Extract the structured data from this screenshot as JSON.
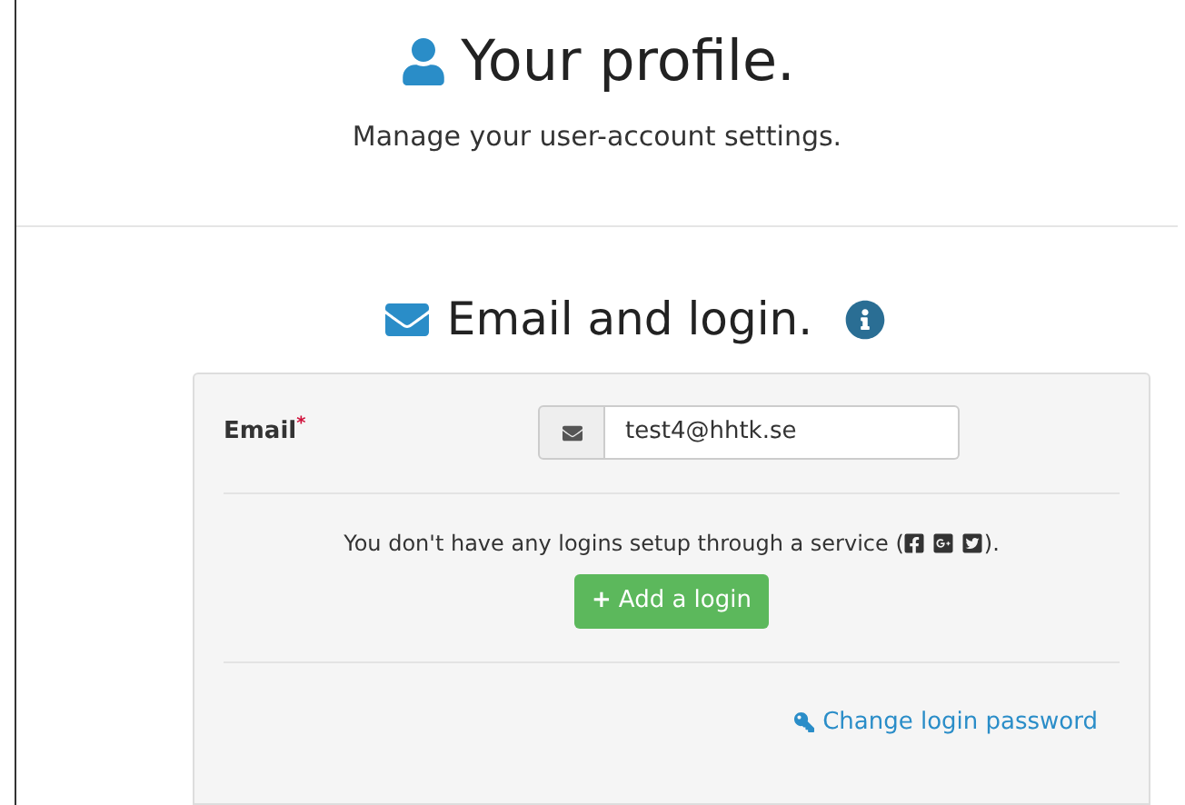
{
  "header": {
    "title": "Your profile.",
    "subtitle": "Manage your user-account settings."
  },
  "section": {
    "title": "Email and login."
  },
  "email_field": {
    "label": "Email",
    "required_mark": "*",
    "value": "test4@hhtk.se"
  },
  "services": {
    "text_before": "You don't have any logins setup through a service (",
    "text_after": ")."
  },
  "add_login_button": {
    "icon": "+",
    "label": "Add a login"
  },
  "change_password_link": "Change login password"
}
